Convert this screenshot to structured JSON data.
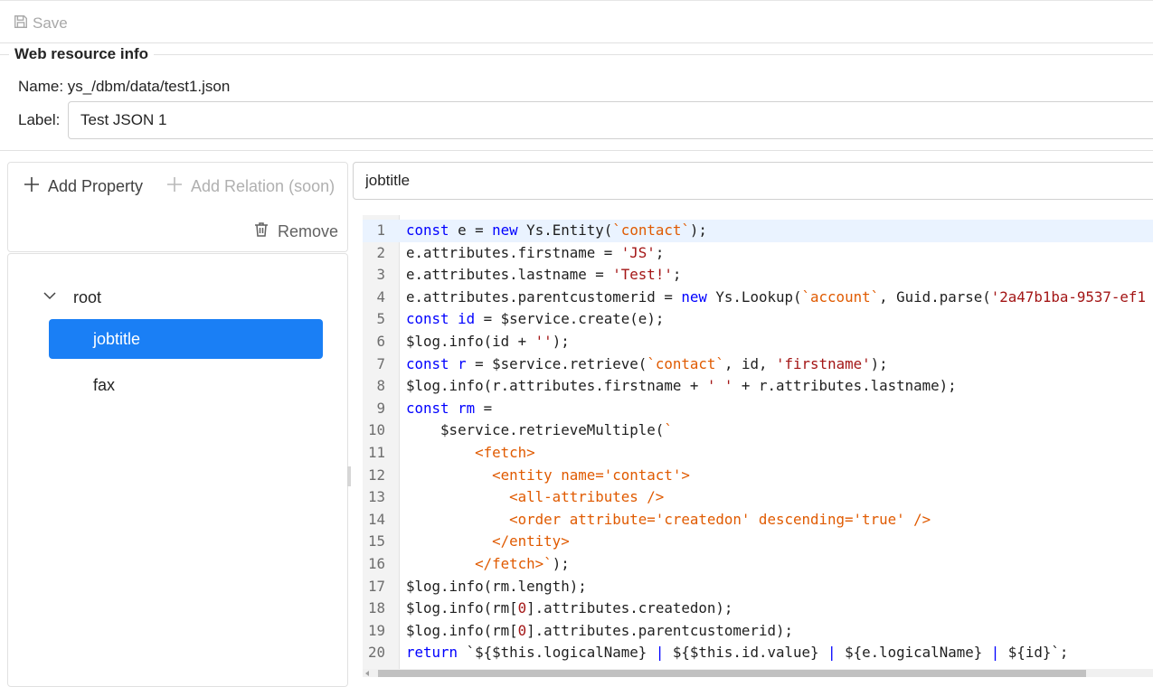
{
  "toolbar": {
    "save_label": "Save"
  },
  "info": {
    "legend": "Web resource info",
    "name_text": "Name: ys_/dbm/data/test1.json",
    "label_caption": "Label:",
    "label_value": "Test JSON 1"
  },
  "left": {
    "add_property": "Add Property",
    "add_relation": "Add Relation (soon)",
    "remove": "Remove",
    "tree": {
      "root": "root",
      "items": [
        "jobtitle",
        "fax"
      ],
      "selected": "jobtitle"
    }
  },
  "right": {
    "property_name": "jobtitle",
    "code_lines": [
      [
        [
          "kw",
          "const"
        ],
        [
          "dim",
          " e = "
        ],
        [
          "kw",
          "new"
        ],
        [
          "dim",
          " Ys.Entity("
        ],
        [
          "tpl",
          "`contact`"
        ],
        [
          "dim",
          ");"
        ]
      ],
      [
        [
          "dim",
          "e.attributes.firstname = "
        ],
        [
          "str",
          "'JS'"
        ],
        [
          "dim",
          ";"
        ]
      ],
      [
        [
          "dim",
          "e.attributes.lastname = "
        ],
        [
          "str",
          "'Test!'"
        ],
        [
          "dim",
          ";"
        ]
      ],
      [
        [
          "dim",
          "e.attributes.parentcustomerid = "
        ],
        [
          "kw",
          "new"
        ],
        [
          "dim",
          " Ys.Lookup("
        ],
        [
          "tpl",
          "`account`"
        ],
        [
          "dim",
          ", Guid.parse("
        ],
        [
          "str",
          "'2a47b1ba-9537-ef1"
        ]
      ],
      [
        [
          "kw",
          "const"
        ],
        [
          "dim",
          " "
        ],
        [
          "kw",
          "id"
        ],
        [
          "dim",
          " = $service.create(e);"
        ]
      ],
      [
        [
          "dim",
          "$log.info(id + "
        ],
        [
          "str",
          "''"
        ],
        [
          "dim",
          ");"
        ]
      ],
      [
        [
          "kw",
          "const"
        ],
        [
          "dim",
          " "
        ],
        [
          "kw",
          "r"
        ],
        [
          "dim",
          " = $service.retrieve("
        ],
        [
          "tpl",
          "`contact`"
        ],
        [
          "dim",
          ", id, "
        ],
        [
          "str",
          "'firstname'"
        ],
        [
          "dim",
          ");"
        ]
      ],
      [
        [
          "dim",
          "$log.info(r.attributes.firstname + "
        ],
        [
          "str",
          "' '"
        ],
        [
          "dim",
          " + r.attributes.lastname);"
        ]
      ],
      [
        [
          "kw",
          "const"
        ],
        [
          "dim",
          " "
        ],
        [
          "kw",
          "rm"
        ],
        [
          "dim",
          " ="
        ]
      ],
      [
        [
          "dim",
          "    $service.retrieveMultiple("
        ],
        [
          "tpl",
          "`"
        ]
      ],
      [
        [
          "tpl",
          "        <fetch>"
        ]
      ],
      [
        [
          "tpl",
          "          <entity name='contact'>"
        ]
      ],
      [
        [
          "tpl",
          "            <all-attributes />"
        ]
      ],
      [
        [
          "tpl",
          "            <order attribute='createdon' descending='true' />"
        ]
      ],
      [
        [
          "tpl",
          "          </entity>"
        ]
      ],
      [
        [
          "tpl",
          "        </fetch>`"
        ],
        [
          "dim",
          ");"
        ]
      ],
      [
        [
          "dim",
          "$log.info(rm.length);"
        ]
      ],
      [
        [
          "dim",
          "$log.info(rm["
        ],
        [
          "str",
          "0"
        ],
        [
          "dim",
          "].attributes.createdon);"
        ]
      ],
      [
        [
          "dim",
          "$log.info(rm["
        ],
        [
          "str",
          "0"
        ],
        [
          "dim",
          "].attributes.parentcustomerid);"
        ]
      ],
      [
        [
          "kw",
          "return"
        ],
        [
          "dim",
          " `${$this.logicalName} "
        ],
        [
          "kw",
          "|"
        ],
        [
          "dim",
          " ${$this.id.value} "
        ],
        [
          "kw",
          "|"
        ],
        [
          "dim",
          " ${e.logicalName} "
        ],
        [
          "kw",
          "|"
        ],
        [
          "dim",
          " ${id}`;"
        ]
      ]
    ]
  }
}
